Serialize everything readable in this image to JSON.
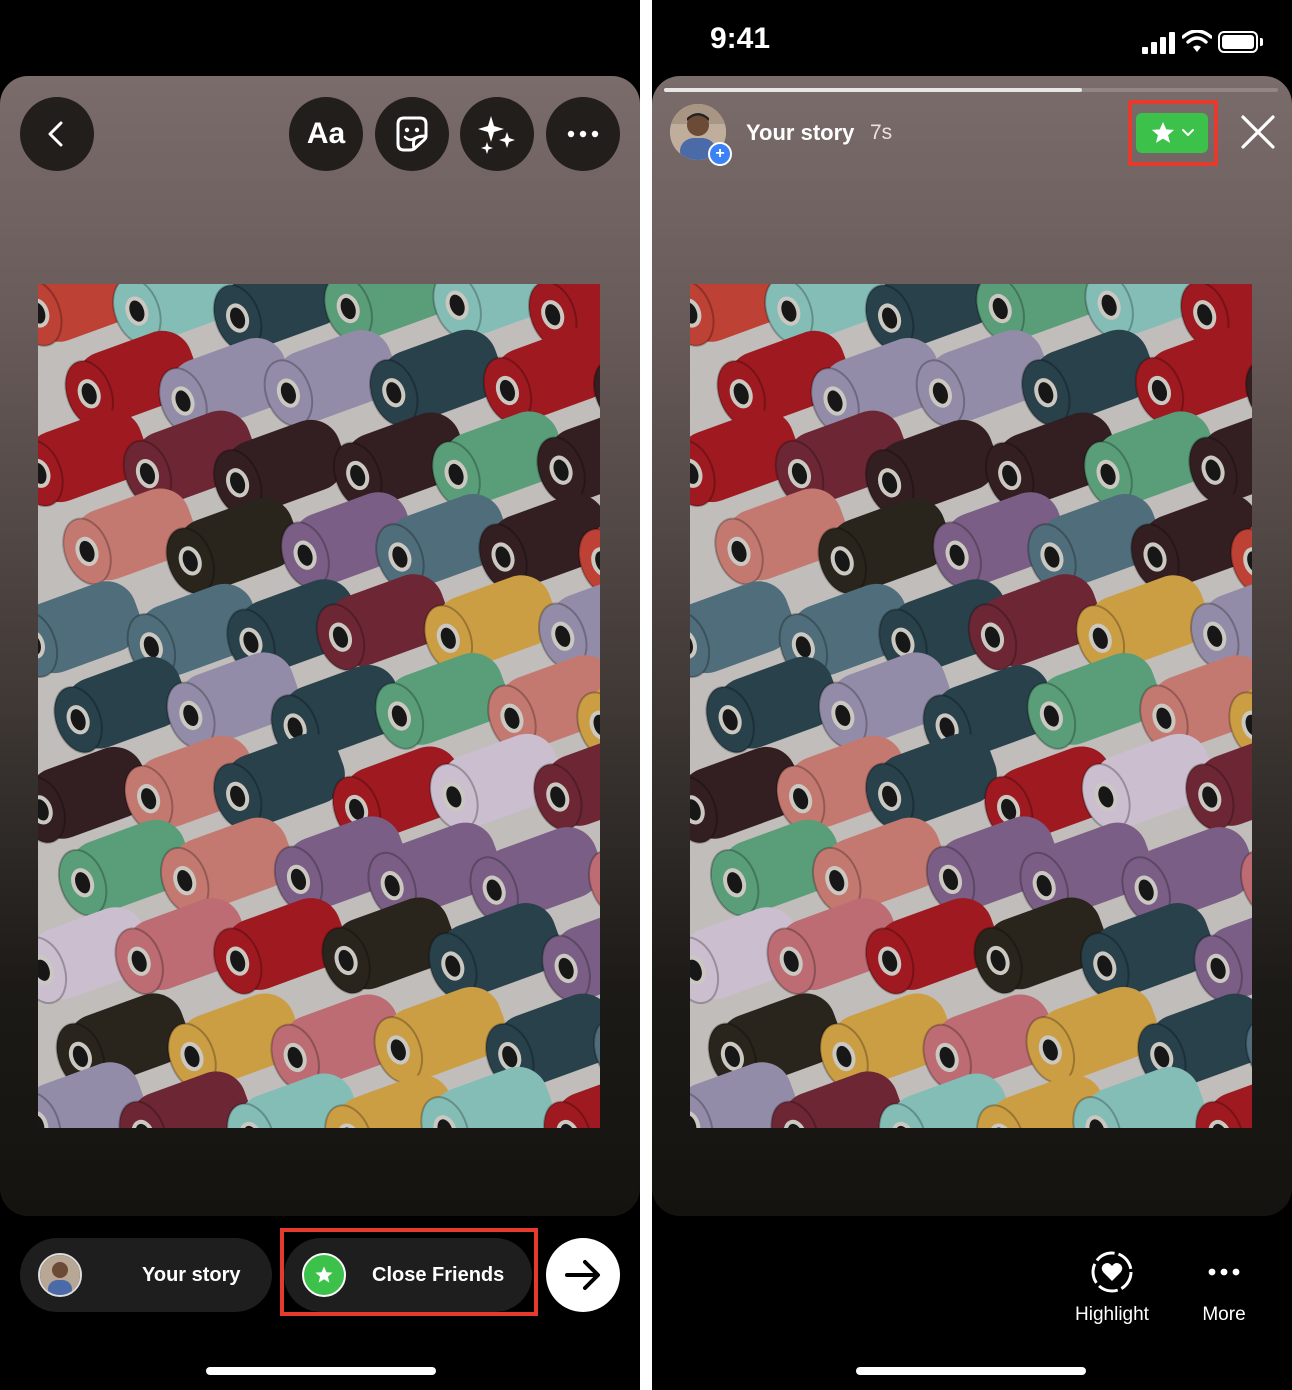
{
  "editor": {
    "text_tool_label": "Aa",
    "share_your_story_label": "Your story",
    "share_close_friends_label": "Close Friends"
  },
  "viewer": {
    "status_time": "9:41",
    "story_name": "Your story",
    "story_age": "7s",
    "progress": 0.68,
    "highlight_label": "Highlight",
    "more_label": "More"
  },
  "colors": {
    "close_friends_green": "#3cc14a",
    "annotation_red": "#e53a2e"
  }
}
